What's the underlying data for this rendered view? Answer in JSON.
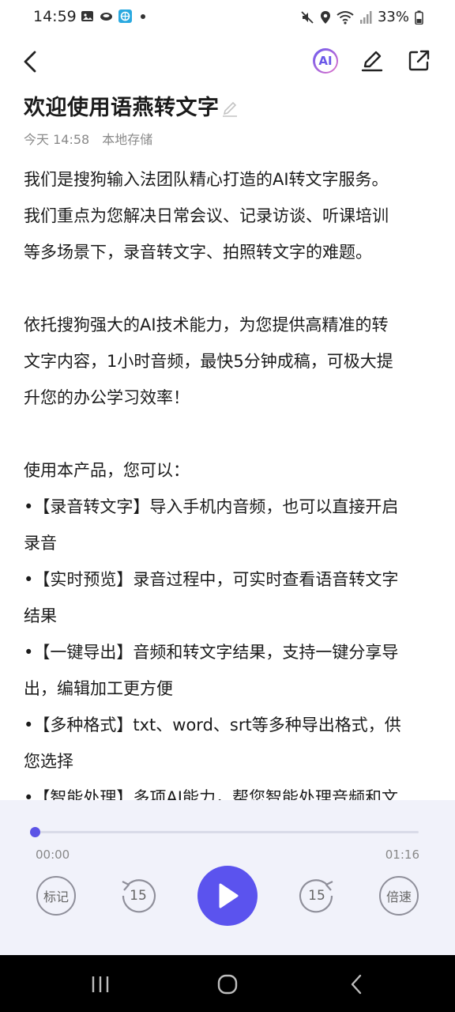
{
  "status_bar": {
    "time": "14:59",
    "battery": "33%",
    "left_icons": [
      "image-icon",
      "cloud-icon",
      "app-icon",
      "dot-icon"
    ],
    "right_icons": [
      "mute-icon",
      "location-icon",
      "wifi-icon",
      "signal-icon",
      "battery-icon"
    ]
  },
  "app_bar": {
    "ai_label": "AI",
    "icons": [
      "back-icon",
      "ai-icon",
      "edit-icon",
      "share-icon"
    ]
  },
  "note": {
    "title": "欢迎使用语燕转文字",
    "date": "今天 14:58",
    "storage": "本地存储",
    "lines": [
      "我们是搜狗输入法团队精心打造的AI转文字服务。",
      "我们重点为您解决日常会议、记录访谈、听课培训",
      "等多场景下，录音转文字、拍照转文字的难题。",
      "",
      "依托搜狗强大的AI技术能力，为您提供高精准的转",
      "文字内容，1小时音频，最快5分钟成稿，可极大提",
      "升您的办公学习效率！",
      "",
      "使用本产品，您可以：",
      "•【录音转文字】导入手机内音频，也可以直接开启",
      "录音",
      "•【实时预览】录音过程中，可实时查看语音转文字",
      "结果",
      "•【一键导出】音频和转文字结果，支持一键分享导",
      "出，编辑加工更方便",
      "•【多种格式】txt、word、srt等多种导出格式，供",
      "您选择",
      "•【智能处理】多项AI能力，帮您智能处理音频和文"
    ]
  },
  "player": {
    "current_time": "00:00",
    "total_time": "01:16",
    "progress": 0.0,
    "mark_label": "标记",
    "rewind_label": "15",
    "forward_label": "15",
    "speed_label": "倍速",
    "accent": "#5b53ee"
  }
}
